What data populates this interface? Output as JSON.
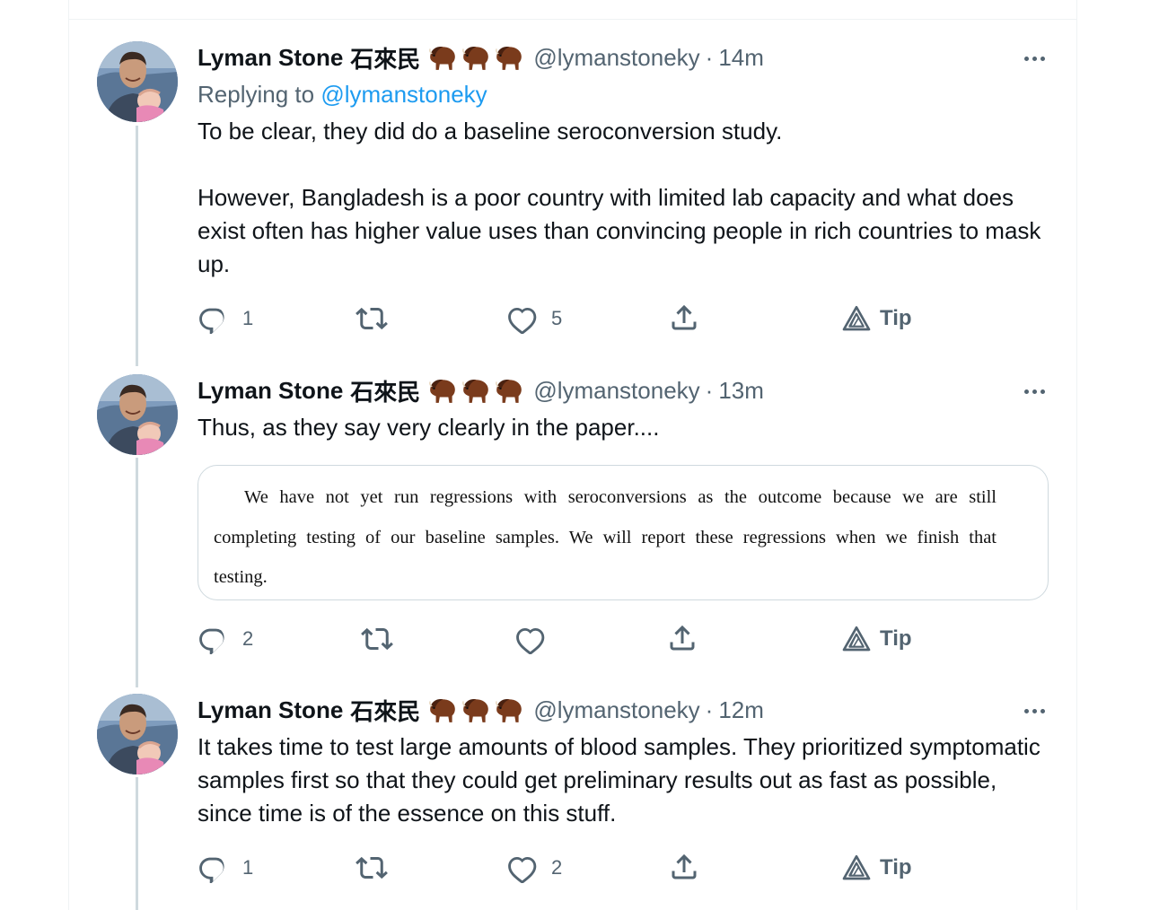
{
  "author": {
    "display_name": "Lyman Stone",
    "cjk_name": "石來民",
    "handle": "@lymanstoneky",
    "badges": [
      "bison-icon",
      "bison-icon",
      "bison-icon"
    ]
  },
  "colors": {
    "link": "#1d9bf0",
    "muted": "#536471",
    "thread_line": "#cfd9de",
    "bison": "#7a3b1c"
  },
  "separator": "·",
  "tip_label": "Tip",
  "tweets": [
    {
      "time": "14m",
      "replying_prefix": "Replying to",
      "replying_handle": "@lymanstoneky",
      "text_p1": "To be clear, they did do a baseline seroconversion study.",
      "text_p2": "However, Bangladesh is a poor country with limited lab capacity and what does exist often has higher value uses than convincing people in rich countries to mask up.",
      "reply_count": "1",
      "retweet_count": "",
      "like_count": "5"
    },
    {
      "time": "13m",
      "text_p1": "Thus, as they say very clearly in the paper....",
      "quote": {
        "line1": "We have not yet run regressions with seroconversions as the outcome because we are still",
        "line2": "completing testing of our baseline samples. We will report these regressions when we finish that",
        "line3": "testing."
      },
      "reply_count": "2",
      "retweet_count": "",
      "like_count": ""
    },
    {
      "time": "12m",
      "text_p1": "It takes time to test large amounts of blood samples. They prioritized symptomatic samples first so that they could get preliminary results out as fast as possible, since time is of the essence on this stuff.",
      "reply_count": "1",
      "retweet_count": "",
      "like_count": "2"
    }
  ]
}
